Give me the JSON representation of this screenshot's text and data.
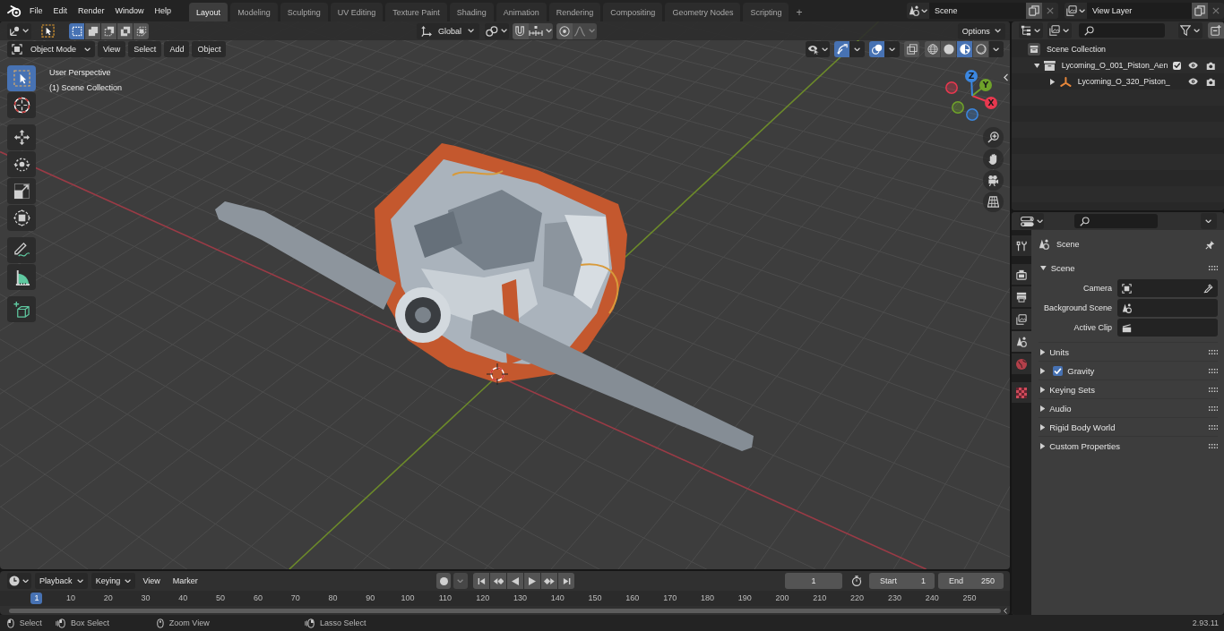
{
  "topbar": {
    "menus": [
      "File",
      "Edit",
      "Render",
      "Window",
      "Help"
    ],
    "workspaces": [
      {
        "label": "Layout",
        "selected": true
      },
      {
        "label": "Modeling",
        "selected": false
      },
      {
        "label": "Sculpting",
        "selected": false
      },
      {
        "label": "UV Editing",
        "selected": false
      },
      {
        "label": "Texture Paint",
        "selected": false
      },
      {
        "label": "Shading",
        "selected": false
      },
      {
        "label": "Animation",
        "selected": false
      },
      {
        "label": "Rendering",
        "selected": false
      },
      {
        "label": "Compositing",
        "selected": false
      },
      {
        "label": "Geometry Nodes",
        "selected": false
      },
      {
        "label": "Scripting",
        "selected": false
      }
    ],
    "add_workspace": "+",
    "scene": "Scene",
    "view_layer": "View Layer"
  },
  "viewport": {
    "header": {
      "select_modes": [
        {
          "kind": "set",
          "selected": true
        },
        {
          "kind": "extend",
          "selected": false
        },
        {
          "kind": "subtract",
          "selected": false
        },
        {
          "kind": "invert",
          "selected": false
        },
        {
          "kind": "intersect",
          "selected": false
        }
      ],
      "orientation": "Global",
      "options": "Options",
      "mode": "Object Mode",
      "menus": [
        "View",
        "Select",
        "Add",
        "Object"
      ],
      "toggles": [
        {
          "kind": "gizmos",
          "on": true
        },
        {
          "kind": "overlays",
          "on": true
        },
        {
          "kind": "xray",
          "on": false
        }
      ],
      "shading": [
        {
          "kind": "wireframe",
          "selected": false
        },
        {
          "kind": "solid",
          "selected": false
        },
        {
          "kind": "material",
          "selected": true
        },
        {
          "kind": "rendered",
          "selected": false
        }
      ]
    },
    "info": [
      "User Perspective",
      "(1) Scene Collection"
    ],
    "tool_groups": [
      [
        {
          "kind": "select_box",
          "selected": true
        },
        {
          "kind": "cursor",
          "selected": false
        }
      ],
      [
        {
          "kind": "move",
          "selected": false
        },
        {
          "kind": "rotate",
          "selected": false
        },
        {
          "kind": "scale",
          "selected": false
        },
        {
          "kind": "transform",
          "selected": false
        }
      ],
      [
        {
          "kind": "annotate",
          "selected": false
        },
        {
          "kind": "measure",
          "selected": false
        }
      ],
      [
        {
          "kind": "add_cube",
          "selected": false
        }
      ]
    ],
    "gizmo_axes": [
      {
        "label": "X",
        "color": "#e8384f"
      },
      {
        "label": "Y",
        "color": "#6fa22a"
      },
      {
        "label": "Z",
        "color": "#3b87e0"
      }
    ]
  },
  "timeline": {
    "menus": [
      "Playback",
      "Keying"
    ],
    "links": [
      "View",
      "Marker"
    ],
    "current_frame": "1",
    "start": {
      "label": "Start",
      "value": "1"
    },
    "end": {
      "label": "End",
      "value": "250"
    },
    "ruler": [
      {
        "label": "1",
        "selected": true
      },
      {
        "label": "10",
        "selected": false
      },
      {
        "label": "20",
        "selected": false
      },
      {
        "label": "30",
        "selected": false
      },
      {
        "label": "40",
        "selected": false
      },
      {
        "label": "50",
        "selected": false
      },
      {
        "label": "60",
        "selected": false
      },
      {
        "label": "70",
        "selected": false
      },
      {
        "label": "80",
        "selected": false
      },
      {
        "label": "90",
        "selected": false
      },
      {
        "label": "100",
        "selected": false
      },
      {
        "label": "110",
        "selected": false
      },
      {
        "label": "120",
        "selected": false
      },
      {
        "label": "130",
        "selected": false
      },
      {
        "label": "140",
        "selected": false
      },
      {
        "label": "150",
        "selected": false
      },
      {
        "label": "160",
        "selected": false
      },
      {
        "label": "170",
        "selected": false
      },
      {
        "label": "180",
        "selected": false
      },
      {
        "label": "190",
        "selected": false
      },
      {
        "label": "200",
        "selected": false
      },
      {
        "label": "210",
        "selected": false
      },
      {
        "label": "220",
        "selected": false
      },
      {
        "label": "230",
        "selected": false
      },
      {
        "label": "240",
        "selected": false
      },
      {
        "label": "250",
        "selected": false
      }
    ]
  },
  "outliner": {
    "tree": [
      {
        "label": "Scene Collection",
        "kind": "scene",
        "children": [
          {
            "label": "Lycoming_O_001_Piston_Aen",
            "kind": "collection",
            "expanded": true,
            "checked": true,
            "children": [
              {
                "label": "Lycoming_O_320_Piston_",
                "kind": "empty",
                "expanded": false
              }
            ]
          }
        ]
      }
    ]
  },
  "properties": {
    "tab_groups": [
      [
        {
          "kind": "tool",
          "selected": false
        }
      ],
      [
        {
          "kind": "render",
          "selected": false
        },
        {
          "kind": "output",
          "selected": false
        },
        {
          "kind": "view_layer",
          "selected": false
        },
        {
          "kind": "scene",
          "selected": true
        },
        {
          "kind": "world",
          "selected": false
        }
      ],
      [
        {
          "kind": "texture",
          "selected": false
        }
      ]
    ],
    "context": "Scene",
    "panel": {
      "title": "Scene",
      "expanded": true,
      "fields": [
        {
          "label": "Camera",
          "kind": "camera"
        },
        {
          "label": "Background Scene",
          "kind": "scene"
        },
        {
          "label": "Active Clip",
          "kind": "clip"
        }
      ]
    },
    "sections": [
      {
        "label": "Units",
        "expanded": false
      },
      {
        "label": "Gravity",
        "expanded": false,
        "checked": true
      },
      {
        "label": "Keying Sets",
        "expanded": false
      },
      {
        "label": "Audio",
        "expanded": false
      },
      {
        "label": "Rigid Body World",
        "expanded": false
      },
      {
        "label": "Custom Properties",
        "expanded": false
      }
    ]
  },
  "status_bar": {
    "hints": [
      {
        "kind": "lmb",
        "label": "Select"
      },
      {
        "kind": "lmb_drag",
        "label": "Box Select"
      },
      {
        "kind": "mmb",
        "label": "Zoom View"
      },
      {
        "kind": "rmb_drag",
        "label": "Lasso Select"
      }
    ],
    "version": "2.93.11"
  }
}
